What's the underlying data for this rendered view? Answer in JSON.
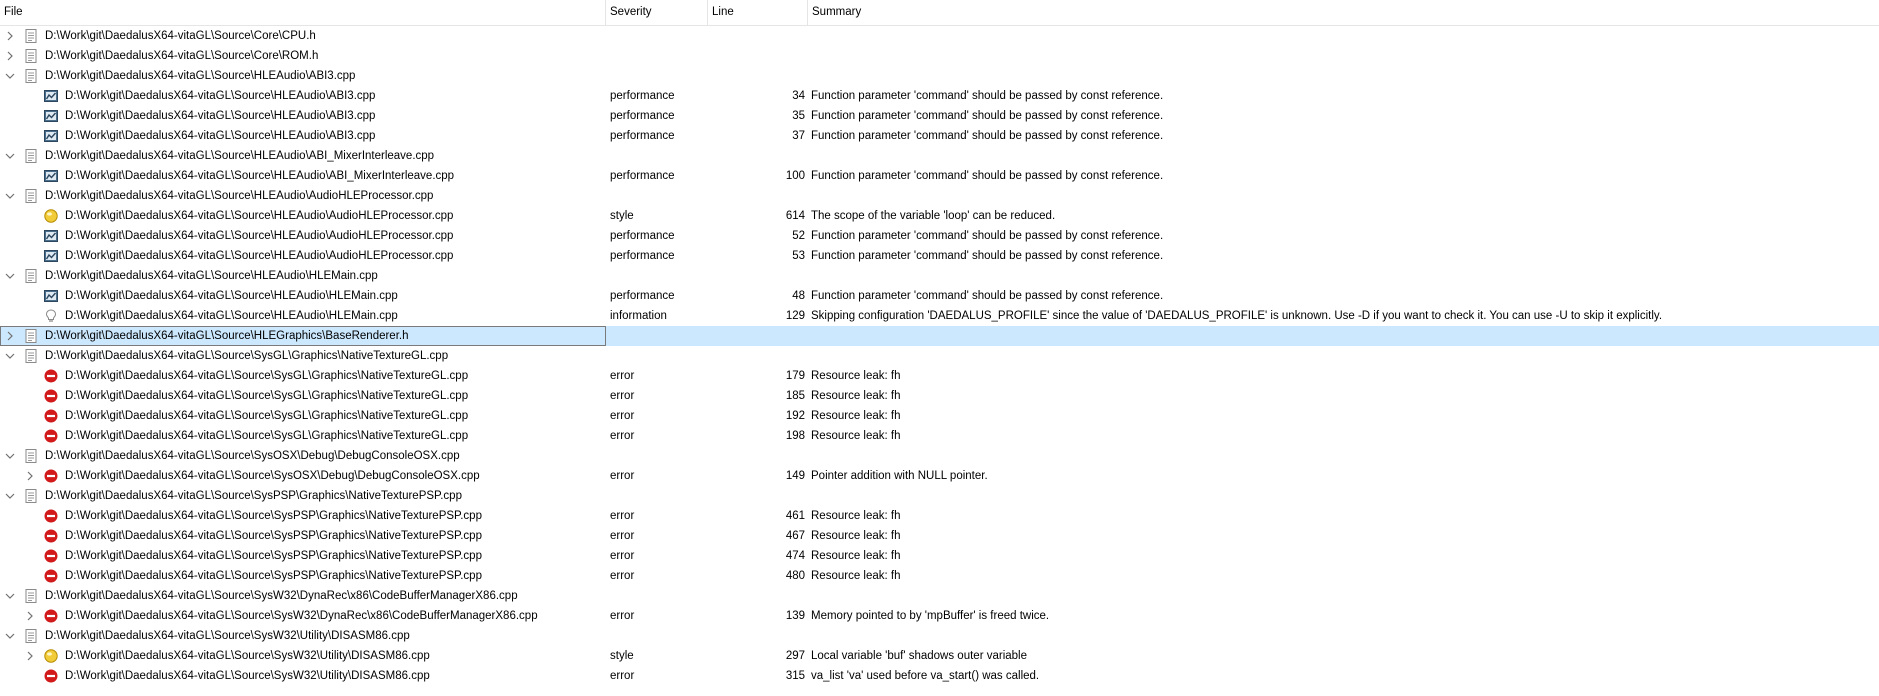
{
  "columns": [
    "File",
    "Severity",
    "Line",
    "Summary"
  ],
  "rows": [
    {
      "level": 0,
      "expander": "collapsed",
      "icon": "file-icon",
      "file": "D:\\Work\\git\\DaedalusX64-vitaGL\\Source\\Core\\CPU.h",
      "severity": "",
      "line": "",
      "summary": ""
    },
    {
      "level": 0,
      "expander": "collapsed",
      "icon": "file-icon",
      "file": "D:\\Work\\git\\DaedalusX64-vitaGL\\Source\\Core\\ROM.h",
      "severity": "",
      "line": "",
      "summary": ""
    },
    {
      "level": 0,
      "expander": "expanded",
      "icon": "file-icon",
      "file": "D:\\Work\\git\\DaedalusX64-vitaGL\\Source\\HLEAudio\\ABI3.cpp",
      "severity": "",
      "line": "",
      "summary": ""
    },
    {
      "level": 1,
      "expander": "none",
      "icon": "performance-icon",
      "file": "D:\\Work\\git\\DaedalusX64-vitaGL\\Source\\HLEAudio\\ABI3.cpp",
      "severity": "performance",
      "line": "34",
      "summary": "Function parameter 'command' should be passed by const reference."
    },
    {
      "level": 1,
      "expander": "none",
      "icon": "performance-icon",
      "file": "D:\\Work\\git\\DaedalusX64-vitaGL\\Source\\HLEAudio\\ABI3.cpp",
      "severity": "performance",
      "line": "35",
      "summary": "Function parameter 'command' should be passed by const reference."
    },
    {
      "level": 1,
      "expander": "none",
      "icon": "performance-icon",
      "file": "D:\\Work\\git\\DaedalusX64-vitaGL\\Source\\HLEAudio\\ABI3.cpp",
      "severity": "performance",
      "line": "37",
      "summary": "Function parameter 'command' should be passed by const reference."
    },
    {
      "level": 0,
      "expander": "expanded",
      "icon": "file-icon",
      "file": "D:\\Work\\git\\DaedalusX64-vitaGL\\Source\\HLEAudio\\ABI_MixerInterleave.cpp",
      "severity": "",
      "line": "",
      "summary": ""
    },
    {
      "level": 1,
      "expander": "none",
      "icon": "performance-icon",
      "file": "D:\\Work\\git\\DaedalusX64-vitaGL\\Source\\HLEAudio\\ABI_MixerInterleave.cpp",
      "severity": "performance",
      "line": "100",
      "summary": "Function parameter 'command' should be passed by const reference."
    },
    {
      "level": 0,
      "expander": "expanded",
      "icon": "file-icon",
      "file": "D:\\Work\\git\\DaedalusX64-vitaGL\\Source\\HLEAudio\\AudioHLEProcessor.cpp",
      "severity": "",
      "line": "",
      "summary": ""
    },
    {
      "level": 1,
      "expander": "none",
      "icon": "style-icon",
      "file": "D:\\Work\\git\\DaedalusX64-vitaGL\\Source\\HLEAudio\\AudioHLEProcessor.cpp",
      "severity": "style",
      "line": "614",
      "summary": "The scope of the variable 'loop' can be reduced."
    },
    {
      "level": 1,
      "expander": "none",
      "icon": "performance-icon",
      "file": "D:\\Work\\git\\DaedalusX64-vitaGL\\Source\\HLEAudio\\AudioHLEProcessor.cpp",
      "severity": "performance",
      "line": "52",
      "summary": "Function parameter 'command' should be passed by const reference."
    },
    {
      "level": 1,
      "expander": "none",
      "icon": "performance-icon",
      "file": "D:\\Work\\git\\DaedalusX64-vitaGL\\Source\\HLEAudio\\AudioHLEProcessor.cpp",
      "severity": "performance",
      "line": "53",
      "summary": "Function parameter 'command' should be passed by const reference."
    },
    {
      "level": 0,
      "expander": "expanded",
      "icon": "file-icon",
      "file": "D:\\Work\\git\\DaedalusX64-vitaGL\\Source\\HLEAudio\\HLEMain.cpp",
      "severity": "",
      "line": "",
      "summary": ""
    },
    {
      "level": 1,
      "expander": "none",
      "icon": "performance-icon",
      "file": "D:\\Work\\git\\DaedalusX64-vitaGL\\Source\\HLEAudio\\HLEMain.cpp",
      "severity": "performance",
      "line": "48",
      "summary": "Function parameter 'command' should be passed by const reference."
    },
    {
      "level": 1,
      "expander": "none",
      "icon": "information-icon",
      "file": "D:\\Work\\git\\DaedalusX64-vitaGL\\Source\\HLEAudio\\HLEMain.cpp",
      "severity": "information",
      "line": "129",
      "summary": "Skipping configuration 'DAEDALUS_PROFILE' since the value of 'DAEDALUS_PROFILE' is unknown. Use -D if you want to check it. You can use -U to skip it explicitly."
    },
    {
      "level": 0,
      "expander": "collapsed",
      "icon": "file-icon",
      "file": "D:\\Work\\git\\DaedalusX64-vitaGL\\Source\\HLEGraphics\\BaseRenderer.h",
      "severity": "",
      "line": "",
      "summary": "",
      "selected": true
    },
    {
      "level": 0,
      "expander": "expanded",
      "icon": "file-icon",
      "file": "D:\\Work\\git\\DaedalusX64-vitaGL\\Source\\SysGL\\Graphics\\NativeTextureGL.cpp",
      "severity": "",
      "line": "",
      "summary": ""
    },
    {
      "level": 1,
      "expander": "none",
      "icon": "error-icon",
      "file": "D:\\Work\\git\\DaedalusX64-vitaGL\\Source\\SysGL\\Graphics\\NativeTextureGL.cpp",
      "severity": "error",
      "line": "179",
      "summary": "Resource leak: fh"
    },
    {
      "level": 1,
      "expander": "none",
      "icon": "error-icon",
      "file": "D:\\Work\\git\\DaedalusX64-vitaGL\\Source\\SysGL\\Graphics\\NativeTextureGL.cpp",
      "severity": "error",
      "line": "185",
      "summary": "Resource leak: fh"
    },
    {
      "level": 1,
      "expander": "none",
      "icon": "error-icon",
      "file": "D:\\Work\\git\\DaedalusX64-vitaGL\\Source\\SysGL\\Graphics\\NativeTextureGL.cpp",
      "severity": "error",
      "line": "192",
      "summary": "Resource leak: fh"
    },
    {
      "level": 1,
      "expander": "none",
      "icon": "error-icon",
      "file": "D:\\Work\\git\\DaedalusX64-vitaGL\\Source\\SysGL\\Graphics\\NativeTextureGL.cpp",
      "severity": "error",
      "line": "198",
      "summary": "Resource leak: fh"
    },
    {
      "level": 0,
      "expander": "expanded",
      "icon": "file-icon",
      "file": "D:\\Work\\git\\DaedalusX64-vitaGL\\Source\\SysOSX\\Debug\\DebugConsoleOSX.cpp",
      "severity": "",
      "line": "",
      "summary": ""
    },
    {
      "level": 1,
      "expander": "collapsed",
      "icon": "error-icon",
      "file": "D:\\Work\\git\\DaedalusX64-vitaGL\\Source\\SysOSX\\Debug\\DebugConsoleOSX.cpp",
      "severity": "error",
      "line": "149",
      "summary": "Pointer addition with NULL pointer."
    },
    {
      "level": 0,
      "expander": "expanded",
      "icon": "file-icon",
      "file": "D:\\Work\\git\\DaedalusX64-vitaGL\\Source\\SysPSP\\Graphics\\NativeTexturePSP.cpp",
      "severity": "",
      "line": "",
      "summary": ""
    },
    {
      "level": 1,
      "expander": "none",
      "icon": "error-icon",
      "file": "D:\\Work\\git\\DaedalusX64-vitaGL\\Source\\SysPSP\\Graphics\\NativeTexturePSP.cpp",
      "severity": "error",
      "line": "461",
      "summary": "Resource leak: fh"
    },
    {
      "level": 1,
      "expander": "none",
      "icon": "error-icon",
      "file": "D:\\Work\\git\\DaedalusX64-vitaGL\\Source\\SysPSP\\Graphics\\NativeTexturePSP.cpp",
      "severity": "error",
      "line": "467",
      "summary": "Resource leak: fh"
    },
    {
      "level": 1,
      "expander": "none",
      "icon": "error-icon",
      "file": "D:\\Work\\git\\DaedalusX64-vitaGL\\Source\\SysPSP\\Graphics\\NativeTexturePSP.cpp",
      "severity": "error",
      "line": "474",
      "summary": "Resource leak: fh"
    },
    {
      "level": 1,
      "expander": "none",
      "icon": "error-icon",
      "file": "D:\\Work\\git\\DaedalusX64-vitaGL\\Source\\SysPSP\\Graphics\\NativeTexturePSP.cpp",
      "severity": "error",
      "line": "480",
      "summary": "Resource leak: fh"
    },
    {
      "level": 0,
      "expander": "expanded",
      "icon": "file-icon",
      "file": "D:\\Work\\git\\DaedalusX64-vitaGL\\Source\\SysW32\\DynaRec\\x86\\CodeBufferManagerX86.cpp",
      "severity": "",
      "line": "",
      "summary": ""
    },
    {
      "level": 1,
      "expander": "collapsed",
      "icon": "error-icon",
      "file": "D:\\Work\\git\\DaedalusX64-vitaGL\\Source\\SysW32\\DynaRec\\x86\\CodeBufferManagerX86.cpp",
      "severity": "error",
      "line": "139",
      "summary": "Memory pointed to by 'mpBuffer' is freed twice."
    },
    {
      "level": 0,
      "expander": "expanded",
      "icon": "file-icon",
      "file": "D:\\Work\\git\\DaedalusX64-vitaGL\\Source\\SysW32\\Utility\\DISASM86.cpp",
      "severity": "",
      "line": "",
      "summary": ""
    },
    {
      "level": 1,
      "expander": "collapsed",
      "icon": "style-icon",
      "file": "D:\\Work\\git\\DaedalusX64-vitaGL\\Source\\SysW32\\Utility\\DISASM86.cpp",
      "severity": "style",
      "line": "297",
      "summary": "Local variable 'buf' shadows outer variable"
    },
    {
      "level": 1,
      "expander": "none",
      "icon": "error-icon",
      "file": "D:\\Work\\git\\DaedalusX64-vitaGL\\Source\\SysW32\\Utility\\DISASM86.cpp",
      "severity": "error",
      "line": "315",
      "summary": "va_list 'va' used before va_start() was called."
    }
  ]
}
